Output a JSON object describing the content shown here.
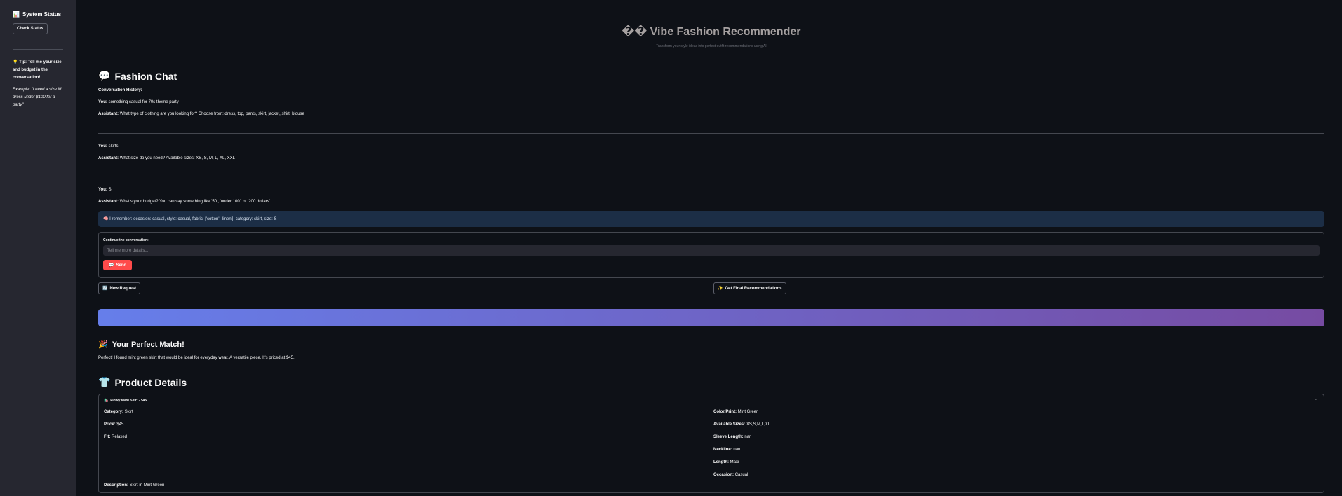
{
  "sidebar": {
    "title": "System Status",
    "title_icon": "📊",
    "check_button": "Check Status",
    "tip_icon": "💡",
    "tip": "Tip: Tell me your size and budget in the conversation!",
    "example": "Example: \"I need a size M dress under $100 for a party\""
  },
  "header": {
    "title": "�� Vibe Fashion Recommender",
    "subtitle": "Transform your style ideas into perfect outfit recommendations using AI"
  },
  "chat": {
    "title": "Fashion Chat",
    "title_icon": "💬",
    "history_label": "Conversation History:",
    "turns": [
      {
        "user": "something casual for 70s theme party",
        "assistant": "What type of clothing are you looking for? Choose from: dress, top, pants, skirt, jacket, shirt, blouse"
      },
      {
        "user": "skirts",
        "assistant": "What size do you need? Available sizes: XS, S, M, L, XL, XXL"
      },
      {
        "user": "S",
        "assistant": "What's your budget? You can say something like '50', 'under 100', or '200 dollars'"
      }
    ],
    "you_label": "You:",
    "assistant_label": "Assistant:",
    "memory": "🧠 I remember: occasion: casual, style: casual, fabric: ['cotton', 'linen'], category: skirt, size: S",
    "form_label": "Continue the conversation:",
    "input_placeholder": "Tell me more details...",
    "send_button": "Send",
    "send_icon": "💬",
    "new_request_button": "New Request",
    "new_request_icon": "🔄",
    "final_button": "Get Final Recommendations",
    "final_icon": "✨"
  },
  "match": {
    "title": "Your Perfect Match!",
    "title_icon": "🎉",
    "text": "Perfect! I found mint green skirt that would be ideal for everyday wear. A versatile piece. It's priced at $45."
  },
  "product": {
    "title": "Product Details",
    "title_icon": "👕",
    "expander_icon": "🛍️",
    "expander_title": "Flowy Maxi Skirt - $45",
    "left": [
      {
        "label": "Category:",
        "value": "Skirt"
      },
      {
        "label": "Price:",
        "value": "$45"
      },
      {
        "label": "Fit:",
        "value": "Relaxed"
      }
    ],
    "right": [
      {
        "label": "Color/Print:",
        "value": "Mint Green"
      },
      {
        "label": "Available Sizes:",
        "value": "XS,S,M,L,XL"
      },
      {
        "label": "Sleeve Length:",
        "value": "nan"
      },
      {
        "label": "Neckline:",
        "value": "nan"
      },
      {
        "label": "Length:",
        "value": "Maxi"
      },
      {
        "label": "Occasion:",
        "value": "Casual"
      }
    ],
    "description_label": "Description:",
    "description": "Skirt in Mint Green"
  }
}
